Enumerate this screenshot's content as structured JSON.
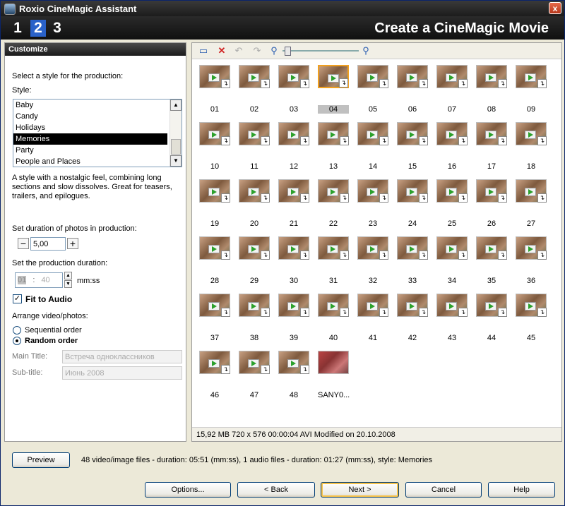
{
  "window": {
    "title": "Roxio CineMagic Assistant",
    "close_label": "x"
  },
  "header": {
    "steps": [
      "1",
      "2",
      "3"
    ],
    "active_step": 2,
    "title": "Create a CineMagic Movie"
  },
  "customize": {
    "panel_title": "Customize",
    "select_style_label": "Select a style for the production:",
    "style_label": "Style:",
    "styles": [
      "Baby",
      "Candy",
      "Holidays",
      "Memories",
      "Party",
      "People and Places"
    ],
    "selected_style": "Memories",
    "description": "A style with a nostalgic feel, combining long sections and slow dissolves. Great for teasers, trailers, and epilogues.",
    "photo_duration_label": "Set duration of photos in production:",
    "photo_duration_value": "5,00",
    "minus_label": "−",
    "plus_label": "+",
    "production_duration_label": "Set the production duration:",
    "duration_min": "01",
    "duration_sep": ":",
    "duration_sec": "40",
    "duration_unit": "mm:ss",
    "fit_to_audio_label": "Fit to Audio",
    "fit_to_audio_checked": true,
    "arrange_label": "Arrange video/photos:",
    "sequential_label": "Sequential order",
    "random_label": "Random order",
    "selected_order": "random",
    "main_title_label": "Main Title:",
    "main_title_value": "Встреча одноклассников",
    "subtitle_label": "Sub-title:",
    "subtitle_value": "Июнь 2008"
  },
  "media": {
    "toolbar_icons": [
      "monitor-icon",
      "delete-icon",
      "rotate-left-icon",
      "rotate-right-icon",
      "zoom-out-icon",
      "zoom-in-icon"
    ],
    "zoom_level": 0.1,
    "items": [
      "01",
      "02",
      "03",
      "04",
      "05",
      "06",
      "07",
      "08",
      "09",
      "10",
      "11",
      "12",
      "13",
      "14",
      "15",
      "16",
      "17",
      "18",
      "19",
      "20",
      "21",
      "22",
      "23",
      "24",
      "25",
      "26",
      "27",
      "28",
      "29",
      "30",
      "31",
      "32",
      "33",
      "34",
      "35",
      "36",
      "37",
      "38",
      "39",
      "40",
      "41",
      "42",
      "43",
      "44",
      "45",
      "46",
      "47",
      "48",
      "SANY0..."
    ],
    "selected_item": "04",
    "status": "15,92 MB   720 x 576 00:00:04 AVI   Modified on 20.10.2008"
  },
  "footer": {
    "preview_label": "Preview",
    "summary": "48 video/image files - duration: 05:51 (mm:ss),  1 audio files - duration: 01:27 (mm:ss), style: Memories",
    "options_label": "Options...",
    "back_label": "< Back",
    "next_label": "Next  >",
    "cancel_label": "Cancel",
    "help_label": "Help"
  },
  "colors": {
    "accent": "#2a62c9",
    "selection": "#000000",
    "highlight": "#f0a020"
  }
}
